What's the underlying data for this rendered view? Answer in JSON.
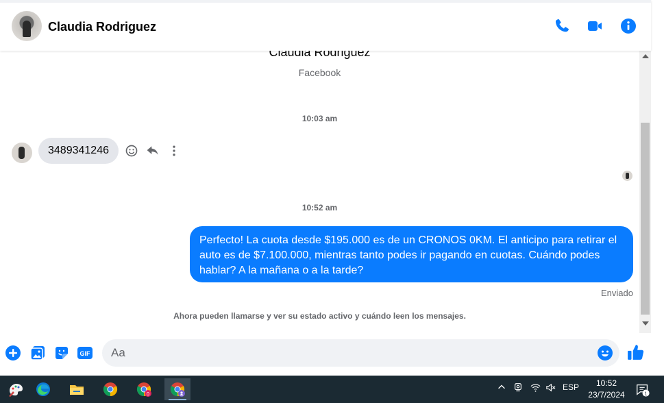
{
  "header": {
    "contact_name": "Claudia Rodriguez",
    "icons": [
      "phone-icon",
      "video-icon",
      "info-icon"
    ],
    "accent": "#0a7cff"
  },
  "conversation": {
    "profile_name": "Claudia Rodriguez",
    "profile_source": "Facebook",
    "timestamp_1": "10:03 am",
    "incoming_message": "3489341246",
    "timestamp_2": "10:52 am",
    "outgoing_message": "Perfecto! La cuota desde $195.000 es de un CRONOS 0KM. El anticipo para retirar el auto es de $7.100.000, mientras tanto podes ir pagando en cuotas. Cuándo podes hablar? A la mañana o a la tarde?",
    "outgoing_status": "Enviado",
    "notice": "Ahora pueden llamarse y ver su estado activo y cuándo leen los mensajes."
  },
  "composer": {
    "placeholder": "Aa",
    "icons": [
      "plus-icon",
      "photo-icon",
      "sticker-icon",
      "gif-icon",
      "emoji-icon",
      "like-icon"
    ],
    "gif_label": "GIF"
  },
  "taskbar": {
    "apps": [
      "paint-icon",
      "edge-icon",
      "file-explorer-icon",
      "chrome-icon",
      "chrome-profile-icon",
      "chrome-profile-2-icon"
    ],
    "chrome_badge": "0",
    "language": "ESP",
    "time": "10:52",
    "date": "23/7/2024",
    "notification_count": "1"
  }
}
